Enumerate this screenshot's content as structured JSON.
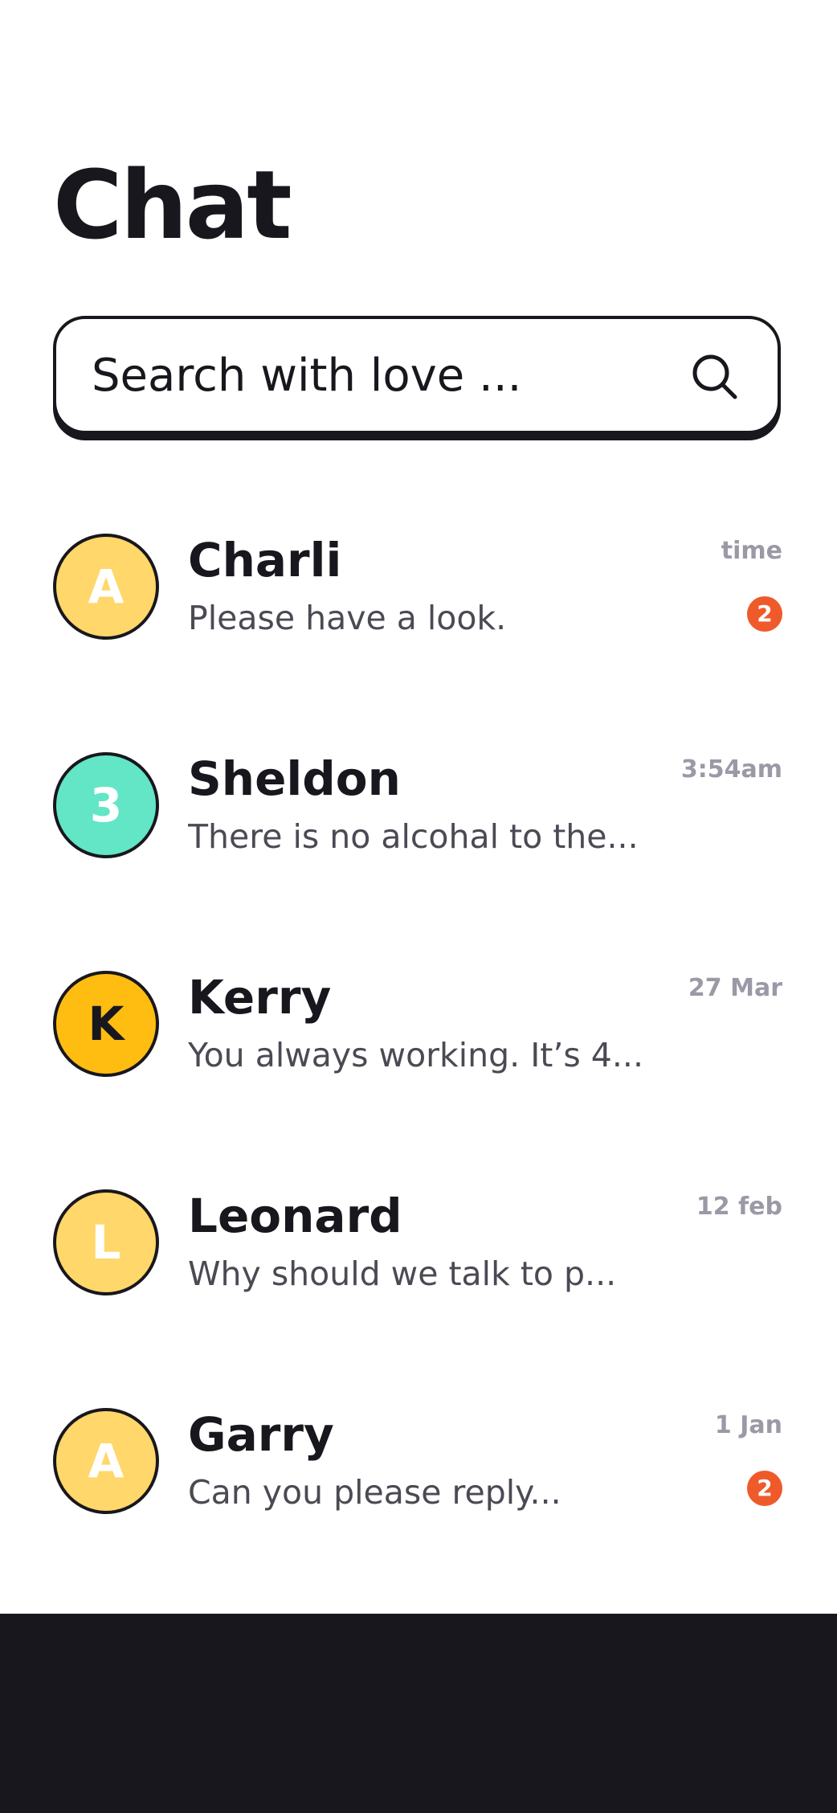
{
  "header": {
    "title": "Chat"
  },
  "search": {
    "placeholder": "Search with love ...",
    "icon": "search-icon"
  },
  "colors": {
    "text_dark": "#18171d",
    "text_muted": "#9a99a6",
    "preview_text": "#4b4a54",
    "badge": "#ef5a2a",
    "bottom_bar": "#18171d"
  },
  "chats": [
    {
      "name": "Charli",
      "preview": "Please have a look.",
      "time": "time",
      "avatar_letter": "A",
      "avatar_color": "#ffd76a",
      "avatar_text_color": "#ffffff",
      "unread": "2"
    },
    {
      "name": "Sheldon",
      "preview": "There is no alcohal to the...",
      "time": "3:54am",
      "avatar_letter": "3",
      "avatar_color": "#63e6c5",
      "avatar_text_color": "#ffffff",
      "unread": null
    },
    {
      "name": "Kerry",
      "preview": "You always working. It’s 4...",
      "time": "27 Mar",
      "avatar_letter": "K",
      "avatar_color": "#ffbd12",
      "avatar_text_color": "#18171d",
      "unread": null
    },
    {
      "name": "Leonard",
      "preview": "Why should we talk to p...",
      "time": "12 feb",
      "avatar_letter": "L",
      "avatar_color": "#ffd76a",
      "avatar_text_color": "#ffffff",
      "unread": null
    },
    {
      "name": "Garry",
      "preview": "Can you please reply...",
      "time": "1 Jan",
      "avatar_letter": "A",
      "avatar_color": "#ffd76a",
      "avatar_text_color": "#ffffff",
      "unread": "2"
    }
  ]
}
